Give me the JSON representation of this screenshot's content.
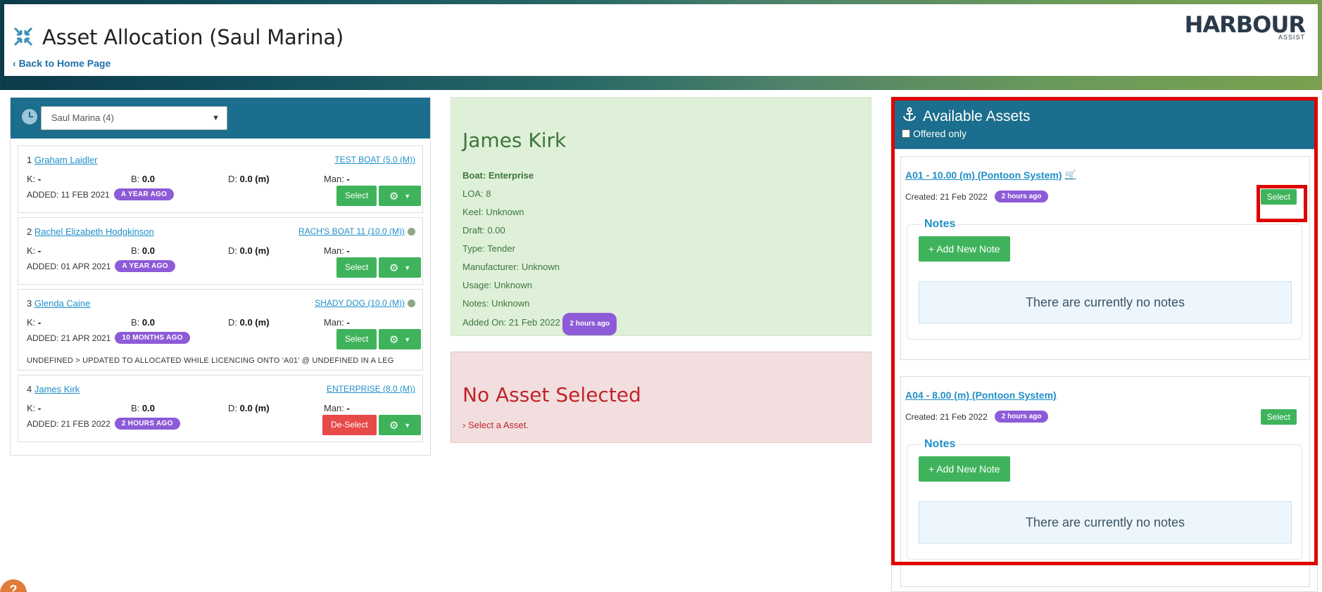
{
  "header": {
    "title": "Asset Allocation (Saul Marina)",
    "back_link": "Back to Home Page",
    "logo_main": "HARBOUR",
    "logo_sub": "ASSIST"
  },
  "left": {
    "marina_select": "Saul Marina (4)",
    "clients": [
      {
        "num": "1",
        "name": "Graham Laidler",
        "boat": "TEST BOAT (5.0 (M))",
        "k": "-",
        "b": "0.0",
        "d": "0.0 (m)",
        "man": "-",
        "added": "ADDED: 11 FEB 2021",
        "badge": "A YEAR AGO",
        "action": "Select",
        "note": ""
      },
      {
        "num": "2",
        "name": "Rachel Elizabeth Hodgkinson",
        "boat": "RACH'S BOAT 11 (10.0 (M))",
        "k": "-",
        "b": "0.0",
        "d": "0.0 (m)",
        "man": "-",
        "added": "ADDED: 01 APR 2021",
        "badge": "A YEAR AGO",
        "action": "Select",
        "note": ""
      },
      {
        "num": "3",
        "name": "Glenda Caine",
        "boat": "SHADY DOG (10.0 (M))",
        "k": "-",
        "b": "0.0",
        "d": "0.0 (m)",
        "man": "-",
        "added": "ADDED: 21 APR 2021",
        "badge": "10 MONTHS AGO",
        "action": "Select",
        "note": "UNDEFINED > UPDATED TO ALLOCATED WHILE LICENCING ONTO 'A01' @ UNDEFINED IN A LEG"
      },
      {
        "num": "4",
        "name": "James Kirk",
        "boat": "ENTERPRISE (8.0 (M))",
        "k": "-",
        "b": "0.0",
        "d": "0.0 (m)",
        "man": "-",
        "added": "ADDED: 21 FEB 2022",
        "badge": "2 HOURS AGO",
        "action": "De-Select",
        "note": ""
      }
    ],
    "labels": {
      "k": "K:",
      "b": "B:",
      "d": "D:",
      "man": "Man:"
    }
  },
  "person": {
    "name": "James Kirk",
    "boat": "Boat: Enterprise",
    "loa": "LOA: 8",
    "keel": "Keel: Unknown",
    "draft": "Draft: 0.00",
    "type": "Type: Tender",
    "manufacturer": "Manufacturer: Unknown",
    "usage": "Usage: Unknown",
    "notes": "Notes: Unknown",
    "added_on": "Added On: 21 Feb 2022",
    "added_badge": "2 hours ago"
  },
  "asset_status": {
    "title": "No Asset Selected",
    "sub": "Select a Asset."
  },
  "available": {
    "title": "Available Assets",
    "offered_only": "Offered only",
    "assets": [
      {
        "label": "A01 - 10.00 (m) (Pontoon System)",
        "created": "Created: 21 Feb 2022",
        "badge": "2 hours ago",
        "select": "Select",
        "notes_label": "Notes",
        "add_note": "Add New Note",
        "no_notes": "There are currently no notes"
      },
      {
        "label": "A04 - 8.00 (m) (Pontoon System)",
        "created": "Created: 21 Feb 2022",
        "badge": "2 hours ago",
        "select": "Select",
        "notes_label": "Notes",
        "add_note": "Add New Note",
        "no_notes": "There are currently no notes"
      }
    ]
  },
  "help": "?"
}
